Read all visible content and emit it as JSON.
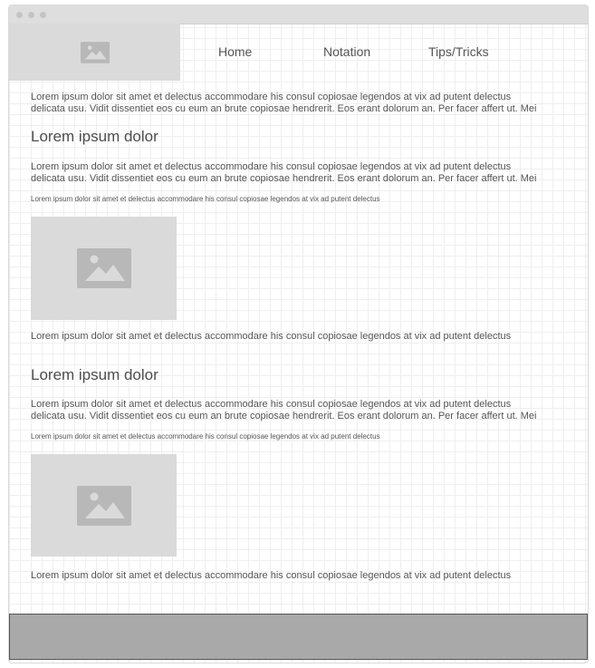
{
  "header": {
    "logo_icon": "image-placeholder-icon",
    "nav": [
      "Home",
      "Notation",
      "Tips/Tricks"
    ]
  },
  "intro": {
    "line1": "Lorem ipsum dolor sit amet et delectus accommodare his consul copiosae legendos at vix ad putent delectus",
    "line2": "delicata usu. Vidit dissentiet eos cu eum an brute copiosae hendrerit. Eos erant dolorum an. Per facer affert ut. Mei"
  },
  "sections": [
    {
      "heading": "Lorem ipsum dolor",
      "para_line1": "Lorem ipsum dolor sit amet et delectus accommodare his consul copiosae legendos at vix ad putent delectus",
      "para_line2": "delicata usu. Vidit dissentiet eos cu eum an brute copiosae hendrerit. Eos erant dolorum an. Per facer affert ut. Mei",
      "small": "Lorem ipsum dolor sit amet et delectus accommodare his consul copiosae legendos at vix ad putent delectus",
      "image_icon": "image-placeholder-icon",
      "caption": "Lorem ipsum dolor sit amet et delectus accommodare his consul copiosae legendos at vix ad putent delectus"
    },
    {
      "heading": "Lorem ipsum dolor",
      "para_line1": "Lorem ipsum dolor sit amet et delectus accommodare his consul copiosae legendos at vix ad putent delectus",
      "para_line2": "delicata usu. Vidit dissentiet eos cu eum an brute copiosae hendrerit. Eos erant dolorum an. Per facer affert ut. Mei",
      "small": "Lorem ipsum dolor sit amet et delectus accommodare his consul copiosae legendos at vix ad putent delectus",
      "image_icon": "image-placeholder-icon",
      "caption": "Lorem ipsum dolor sit amet et delectus accommodare his consul copiosae legendos at vix ad putent delectus"
    }
  ],
  "colors": {
    "placeholder": "#dadada",
    "placeholder_icon": "#b8b8b8",
    "footer": "#a9a9a9",
    "text": "#555555"
  }
}
